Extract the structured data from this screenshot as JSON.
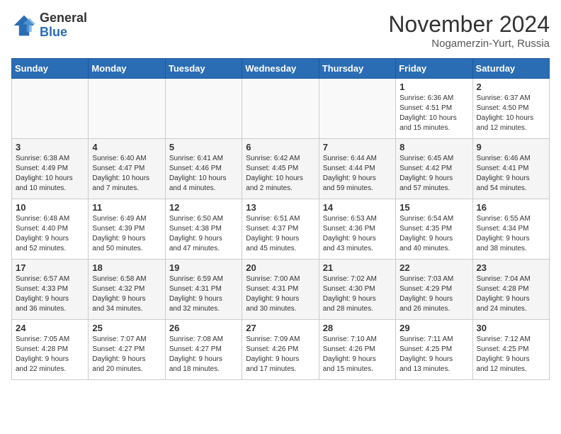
{
  "header": {
    "logo_line1": "General",
    "logo_line2": "Blue",
    "month_title": "November 2024",
    "location": "Nogamerzin-Yurt, Russia"
  },
  "weekdays": [
    "Sunday",
    "Monday",
    "Tuesday",
    "Wednesday",
    "Thursday",
    "Friday",
    "Saturday"
  ],
  "weeks": [
    [
      {
        "day": "",
        "info": ""
      },
      {
        "day": "",
        "info": ""
      },
      {
        "day": "",
        "info": ""
      },
      {
        "day": "",
        "info": ""
      },
      {
        "day": "",
        "info": ""
      },
      {
        "day": "1",
        "info": "Sunrise: 6:36 AM\nSunset: 4:51 PM\nDaylight: 10 hours\nand 15 minutes."
      },
      {
        "day": "2",
        "info": "Sunrise: 6:37 AM\nSunset: 4:50 PM\nDaylight: 10 hours\nand 12 minutes."
      }
    ],
    [
      {
        "day": "3",
        "info": "Sunrise: 6:38 AM\nSunset: 4:49 PM\nDaylight: 10 hours\nand 10 minutes."
      },
      {
        "day": "4",
        "info": "Sunrise: 6:40 AM\nSunset: 4:47 PM\nDaylight: 10 hours\nand 7 minutes."
      },
      {
        "day": "5",
        "info": "Sunrise: 6:41 AM\nSunset: 4:46 PM\nDaylight: 10 hours\nand 4 minutes."
      },
      {
        "day": "6",
        "info": "Sunrise: 6:42 AM\nSunset: 4:45 PM\nDaylight: 10 hours\nand 2 minutes."
      },
      {
        "day": "7",
        "info": "Sunrise: 6:44 AM\nSunset: 4:44 PM\nDaylight: 9 hours\nand 59 minutes."
      },
      {
        "day": "8",
        "info": "Sunrise: 6:45 AM\nSunset: 4:42 PM\nDaylight: 9 hours\nand 57 minutes."
      },
      {
        "day": "9",
        "info": "Sunrise: 6:46 AM\nSunset: 4:41 PM\nDaylight: 9 hours\nand 54 minutes."
      }
    ],
    [
      {
        "day": "10",
        "info": "Sunrise: 6:48 AM\nSunset: 4:40 PM\nDaylight: 9 hours\nand 52 minutes."
      },
      {
        "day": "11",
        "info": "Sunrise: 6:49 AM\nSunset: 4:39 PM\nDaylight: 9 hours\nand 50 minutes."
      },
      {
        "day": "12",
        "info": "Sunrise: 6:50 AM\nSunset: 4:38 PM\nDaylight: 9 hours\nand 47 minutes."
      },
      {
        "day": "13",
        "info": "Sunrise: 6:51 AM\nSunset: 4:37 PM\nDaylight: 9 hours\nand 45 minutes."
      },
      {
        "day": "14",
        "info": "Sunrise: 6:53 AM\nSunset: 4:36 PM\nDaylight: 9 hours\nand 43 minutes."
      },
      {
        "day": "15",
        "info": "Sunrise: 6:54 AM\nSunset: 4:35 PM\nDaylight: 9 hours\nand 40 minutes."
      },
      {
        "day": "16",
        "info": "Sunrise: 6:55 AM\nSunset: 4:34 PM\nDaylight: 9 hours\nand 38 minutes."
      }
    ],
    [
      {
        "day": "17",
        "info": "Sunrise: 6:57 AM\nSunset: 4:33 PM\nDaylight: 9 hours\nand 36 minutes."
      },
      {
        "day": "18",
        "info": "Sunrise: 6:58 AM\nSunset: 4:32 PM\nDaylight: 9 hours\nand 34 minutes."
      },
      {
        "day": "19",
        "info": "Sunrise: 6:59 AM\nSunset: 4:31 PM\nDaylight: 9 hours\nand 32 minutes."
      },
      {
        "day": "20",
        "info": "Sunrise: 7:00 AM\nSunset: 4:31 PM\nDaylight: 9 hours\nand 30 minutes."
      },
      {
        "day": "21",
        "info": "Sunrise: 7:02 AM\nSunset: 4:30 PM\nDaylight: 9 hours\nand 28 minutes."
      },
      {
        "day": "22",
        "info": "Sunrise: 7:03 AM\nSunset: 4:29 PM\nDaylight: 9 hours\nand 26 minutes."
      },
      {
        "day": "23",
        "info": "Sunrise: 7:04 AM\nSunset: 4:28 PM\nDaylight: 9 hours\nand 24 minutes."
      }
    ],
    [
      {
        "day": "24",
        "info": "Sunrise: 7:05 AM\nSunset: 4:28 PM\nDaylight: 9 hours\nand 22 minutes."
      },
      {
        "day": "25",
        "info": "Sunrise: 7:07 AM\nSunset: 4:27 PM\nDaylight: 9 hours\nand 20 minutes."
      },
      {
        "day": "26",
        "info": "Sunrise: 7:08 AM\nSunset: 4:27 PM\nDaylight: 9 hours\nand 18 minutes."
      },
      {
        "day": "27",
        "info": "Sunrise: 7:09 AM\nSunset: 4:26 PM\nDaylight: 9 hours\nand 17 minutes."
      },
      {
        "day": "28",
        "info": "Sunrise: 7:10 AM\nSunset: 4:26 PM\nDaylight: 9 hours\nand 15 minutes."
      },
      {
        "day": "29",
        "info": "Sunrise: 7:11 AM\nSunset: 4:25 PM\nDaylight: 9 hours\nand 13 minutes."
      },
      {
        "day": "30",
        "info": "Sunrise: 7:12 AM\nSunset: 4:25 PM\nDaylight: 9 hours\nand 12 minutes."
      }
    ]
  ]
}
